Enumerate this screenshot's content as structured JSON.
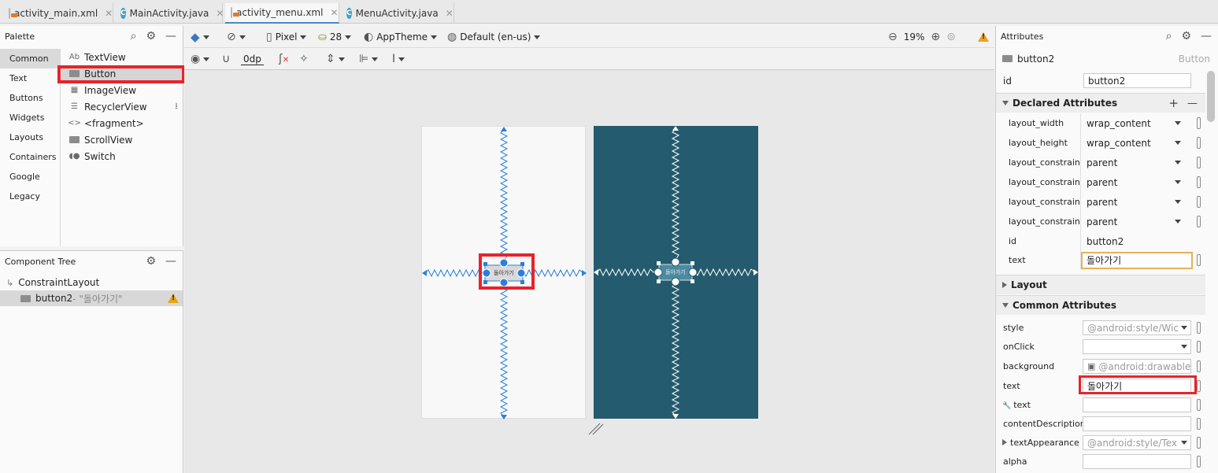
{
  "tabs": [
    {
      "label": "activity_main.xml",
      "type": "xml",
      "active": false
    },
    {
      "label": "MainActivity.java",
      "type": "java",
      "active": false
    },
    {
      "label": "activity_menu.xml",
      "type": "xml",
      "active": true
    },
    {
      "label": "MenuActivity.java",
      "type": "java",
      "active": false
    }
  ],
  "palette": {
    "title": "Palette",
    "categories": [
      "Common",
      "Text",
      "Buttons",
      "Widgets",
      "Layouts",
      "Containers",
      "Google",
      "Legacy"
    ],
    "items": [
      {
        "label": "TextView",
        "icon": "Ab"
      },
      {
        "label": "Button",
        "icon": "button-icon"
      },
      {
        "label": "ImageView",
        "icon": "image-icon"
      },
      {
        "label": "RecyclerView",
        "icon": "list-icon"
      },
      {
        "label": "<fragment>",
        "icon": "<>"
      },
      {
        "label": "ScrollView",
        "icon": "scroll-icon"
      },
      {
        "label": "Switch",
        "icon": "switch-icon"
      }
    ]
  },
  "component_tree": {
    "title": "Component Tree",
    "root": "ConstraintLayout",
    "child_name": "button2",
    "child_text": "- \"돌아가기\""
  },
  "toolbar": {
    "device": "Pixel",
    "api": "28",
    "theme": "AppTheme",
    "locale": "Default (en-us)",
    "zoom": "19%",
    "margin": "0dp"
  },
  "design": {
    "button_text": "돌아가기"
  },
  "attributes": {
    "title": "Attributes",
    "component": "button2",
    "component_type": "Button",
    "id_label": "id",
    "id_value": "button2",
    "declared_title": "Declared Attributes",
    "declared": [
      {
        "name": "layout_width",
        "value": "wrap_content"
      },
      {
        "name": "layout_height",
        "value": "wrap_content"
      },
      {
        "name": "layout_constraintB",
        "value": "parent"
      },
      {
        "name": "layout_constraintE",
        "value": "parent"
      },
      {
        "name": "layout_constraintS",
        "value": "parent"
      },
      {
        "name": "layout_constraintT",
        "value": "parent"
      },
      {
        "name": "id",
        "value": "button2"
      },
      {
        "name": "text",
        "value": "돌아가기"
      }
    ],
    "layout_title": "Layout",
    "common_title": "Common Attributes",
    "common": [
      {
        "name": "style",
        "value": "@android:style/Wic"
      },
      {
        "name": "onClick",
        "value": ""
      },
      {
        "name": "background",
        "value": "@android:drawable/b"
      },
      {
        "name": "text",
        "value": "돌아가기"
      },
      {
        "name": "text",
        "value": ""
      },
      {
        "name": "contentDescription",
        "value": ""
      },
      {
        "name": "textAppearance",
        "value": "@android:style/Tex"
      },
      {
        "name": "alpha",
        "value": ""
      }
    ]
  },
  "colors": {
    "accent": "#2b7fdb",
    "highlight": "#e8232a",
    "blueprint": "#245b6e",
    "warning": "#e7a31a"
  }
}
